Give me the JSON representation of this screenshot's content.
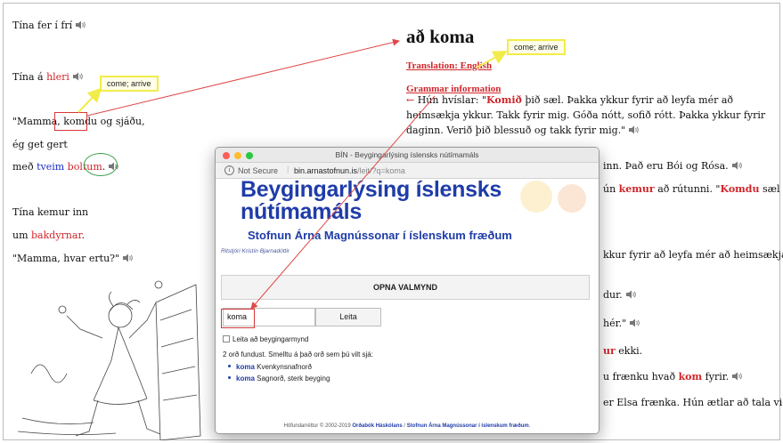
{
  "left_story": {
    "line1": {
      "pre": "Tína fer í frí",
      "speaker": "speaker-icon"
    },
    "line2": {
      "pre": "Tína á ",
      "red": "hleri"
    },
    "line3": {
      "pre": "\"Mamma, ",
      "boxed": "komdu",
      "post": " og sjáðu,"
    },
    "line4": {
      "text": "ég get gert"
    },
    "line5": {
      "pre": "með ",
      "blue": "tveim",
      "red": "boltum",
      "post": "."
    },
    "line6": {
      "text": "Tína kemur inn"
    },
    "line7": {
      "pre": "um ",
      "red": "bakdyrnar",
      "post": "."
    },
    "line8": {
      "text": "\"Mamma, hvar ertu?\""
    }
  },
  "tooltips": {
    "left": "come; arrive",
    "right": "come; arrive"
  },
  "word_panel": {
    "title": "að koma",
    "translation_link": "Translation: English",
    "grammar_link": "Grammar information",
    "story": {
      "arrow": "←",
      "p1_pre": " Hún hvíslar: \"",
      "p1_red": "Komið",
      "p1_post": " þið sæl. Þakka ykkur fyrir að leyfa mér að heimsækja ykkur. Takk fyrir mig. Góða nótt, sofið rótt. Þakka ykkur fyrir daginn. Verið þið blessuð og takk fyrir mig.\""
    },
    "right_fragments": {
      "f1": "inn. Það eru Bói og Rósa.",
      "f2_pre": "ún ",
      "f2_red1": "kemur",
      "f2_mid": " að rútunni. \"",
      "f2_red2": "Komdu",
      "f2_post": " sæl Tína og",
      "f3": "kkur fyrir að leyfa mér að heimsækja",
      "f4": "dur.",
      "f5": "hér.\"",
      "f6_red": "ur",
      "f6_post": " ekki.",
      "f7_pre": "u frænku hvað ",
      "f7_red": "kom",
      "f7_post": " fyrir.",
      "f8": "er Elsa frænka. Hún ætlar að tala við þig.\""
    }
  },
  "browser": {
    "window_title": "BÍN - Beygingarlýsing íslensks nútímamáls",
    "security": "Not Secure",
    "url_host": "bin.arnastofnun.is",
    "url_path": "/leit/?q=koma",
    "heading_line1": "Beygingarlýsing íslensks",
    "heading_line2": "nútímamáls",
    "subheading": "Stofnun Árna Magnússonar í íslenskum fræðum",
    "editor": "Ritstjóri Kristín Bjarnadóttir",
    "menu_button": "OPNA VALMYND",
    "search_value": "koma",
    "search_button": "Leita",
    "checkbox_label": "Leita að beygingarmynd",
    "found_text": "2 orð fundust. Smelltu á það orð sem þú vilt sjá:",
    "results": [
      {
        "word": "koma",
        "desc": "Kvenkynsnafnorð"
      },
      {
        "word": "koma",
        "desc": "Sagnorð, sterk beyging"
      }
    ],
    "footer_pre": "Höfundarréttur © 2002-2019 ",
    "footer_link1": "Orðabók Háskólans",
    "footer_sep": " / ",
    "footer_link2": "Stofnun Árna Magnússonar í íslenskum fræðum",
    "footer_post": "."
  },
  "colors": {
    "accent_red": "#d0262b",
    "link_blue": "#1f3ca8",
    "tooltip_border": "#f1ec4a",
    "arrow_red": "#e04848",
    "arrow_yellow": "#f1ec4a",
    "ring_green": "#3aa04a"
  }
}
